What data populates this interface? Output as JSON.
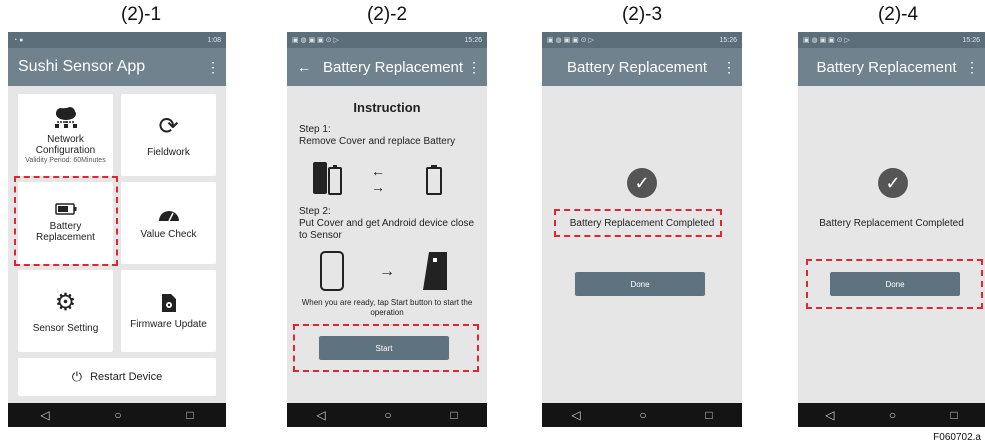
{
  "panels": {
    "p1": {
      "label": "(2)-1"
    },
    "p2": {
      "label": "(2)-2"
    },
    "p3": {
      "label": "(2)-3"
    },
    "p4": {
      "label": "(2)-4"
    }
  },
  "status": {
    "time_p1": "1:08",
    "time_other": "15:26"
  },
  "home": {
    "title": "Sushi Sensor App",
    "tiles": {
      "network": "Network Configuration",
      "network_sub": "Validity Period: 60Minutes",
      "fieldwork": "Fieldwork",
      "battery": "Battery Replacement",
      "value_check": "Value Check",
      "sensor_setting": "Sensor Setting",
      "firmware_update": "Firmware Update",
      "restart": "Restart Device"
    }
  },
  "battery_screen": {
    "title": "Battery Replacement",
    "instruction_title": "Instruction",
    "step1_heading": "Step 1:",
    "step1_text": "Remove Cover and replace Battery",
    "step2_heading": "Step 2:",
    "step2_text": "Put Cover and get Android device close to Sensor",
    "ready_note": "When you are ready, tap Start button to start the operation",
    "start_label": "Start"
  },
  "completed_screen": {
    "title": "Battery Replacement",
    "message": "Battery Replacement Completed",
    "done_label": "Done"
  },
  "figure_id": "F060702.a",
  "colors": {
    "highlight": "#e0262f",
    "appbar": "#6f828e",
    "button": "#5f7280"
  }
}
